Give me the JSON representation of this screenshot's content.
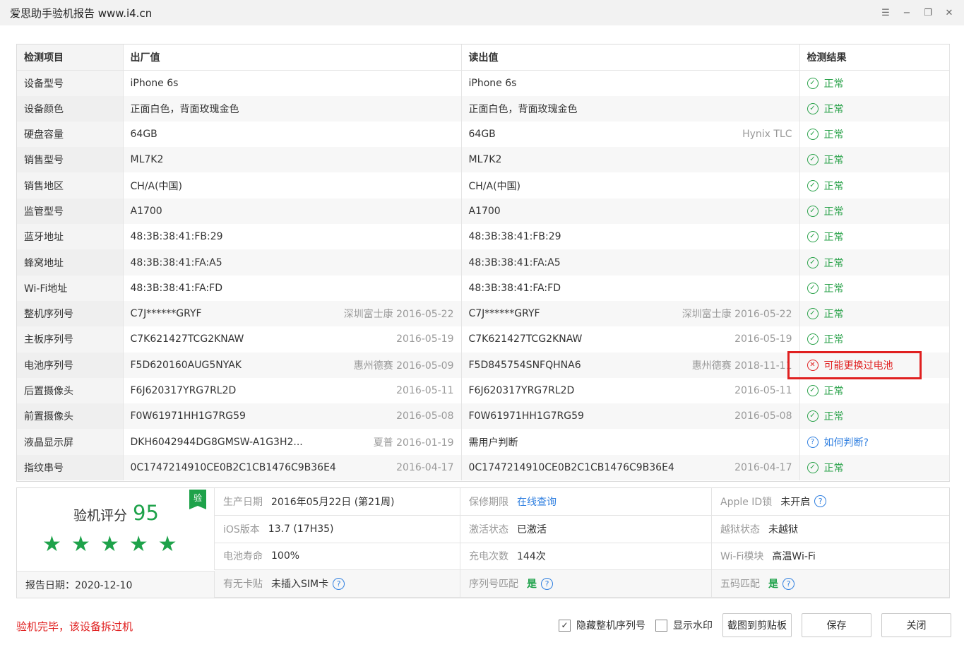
{
  "window": {
    "title": "爱思助手验机报告 www.i4.cn",
    "menu_icon": "☰",
    "minimize_icon": "−",
    "restore_icon": "❐",
    "close_icon": "✕"
  },
  "table": {
    "headers": [
      "检测项目",
      "出厂值",
      "读出值",
      "检测结果"
    ],
    "rows": [
      {
        "item": "设备型号",
        "factory": "iPhone 6s",
        "factory_meta": "",
        "read": "iPhone 6s",
        "read_meta": "",
        "result": "正常",
        "status": "ok"
      },
      {
        "item": "设备颜色",
        "factory": "正面白色，背面玫瑰金色",
        "factory_meta": "",
        "read": "正面白色，背面玫瑰金色",
        "read_meta": "",
        "result": "正常",
        "status": "ok"
      },
      {
        "item": "硬盘容量",
        "factory": "64GB",
        "factory_meta": "",
        "read": "64GB",
        "read_meta": "Hynix TLC",
        "result": "正常",
        "status": "ok"
      },
      {
        "item": "销售型号",
        "factory": "ML7K2",
        "factory_meta": "",
        "read": "ML7K2",
        "read_meta": "",
        "result": "正常",
        "status": "ok"
      },
      {
        "item": "销售地区",
        "factory": "CH/A(中国)",
        "factory_meta": "",
        "read": "CH/A(中国)",
        "read_meta": "",
        "result": "正常",
        "status": "ok"
      },
      {
        "item": "监管型号",
        "factory": "A1700",
        "factory_meta": "",
        "read": "A1700",
        "read_meta": "",
        "result": "正常",
        "status": "ok"
      },
      {
        "item": "蓝牙地址",
        "factory": "48:3B:38:41:FB:29",
        "factory_meta": "",
        "read": "48:3B:38:41:FB:29",
        "read_meta": "",
        "result": "正常",
        "status": "ok"
      },
      {
        "item": "蜂窝地址",
        "factory": "48:3B:38:41:FA:A5",
        "factory_meta": "",
        "read": "48:3B:38:41:FA:A5",
        "read_meta": "",
        "result": "正常",
        "status": "ok"
      },
      {
        "item": "Wi-Fi地址",
        "factory": "48:3B:38:41:FA:FD",
        "factory_meta": "",
        "read": "48:3B:38:41:FA:FD",
        "read_meta": "",
        "result": "正常",
        "status": "ok"
      },
      {
        "item": "整机序列号",
        "factory": "C7J******GRYF",
        "factory_meta": "深圳富士康 2016-05-22",
        "read": "C7J******GRYF",
        "read_meta": "深圳富士康 2016-05-22",
        "result": "正常",
        "status": "ok"
      },
      {
        "item": "主板序列号",
        "factory": "C7K621427TCG2KNAW",
        "factory_meta": "2016-05-19",
        "read": "C7K621427TCG2KNAW",
        "read_meta": "2016-05-19",
        "result": "正常",
        "status": "ok"
      },
      {
        "item": "电池序列号",
        "factory": "F5D620160AUG5NYAK",
        "factory_meta": "惠州德赛 2016-05-09",
        "read": "F5D845754SNFQHNA6",
        "read_meta": "惠州德赛 2018-11-11",
        "result": "可能更换过电池",
        "status": "bad"
      },
      {
        "item": "后置摄像头",
        "factory": "F6J620317YRG7RL2D",
        "factory_meta": "2016-05-11",
        "read": "F6J620317YRG7RL2D",
        "read_meta": "2016-05-11",
        "result": "正常",
        "status": "ok"
      },
      {
        "item": "前置摄像头",
        "factory": "F0W61971HH1G7RG59",
        "factory_meta": "2016-05-08",
        "read": "F0W61971HH1G7RG59",
        "read_meta": "2016-05-08",
        "result": "正常",
        "status": "ok"
      },
      {
        "item": "液晶显示屏",
        "factory": "DKH6042944DG8GMSW-A1G3H2...",
        "factory_meta": "夏普 2016-01-19",
        "read": "需用户判断",
        "read_meta": "",
        "result": "如何判断?",
        "status": "info"
      },
      {
        "item": "指纹串号",
        "factory": "0C1747214910CE0B2C1CB1476C9B36E4",
        "factory_meta": "2016-04-17",
        "read": "0C1747214910CE0B2C1CB1476C9B36E4",
        "read_meta": "2016-04-17",
        "result": "正常",
        "status": "ok"
      }
    ]
  },
  "score": {
    "label": "验机评分",
    "value": "95",
    "stars": 5,
    "badge": "验",
    "report_date": "报告日期：2020-12-10"
  },
  "info_grid": [
    [
      {
        "label": "生产日期",
        "value": "2016年05月22日 (第21周)",
        "style": "",
        "help": false
      },
      {
        "label": "保修期限",
        "value": "在线查询",
        "style": "link",
        "help": false
      },
      {
        "label": "Apple ID锁",
        "value": "未开启",
        "style": "",
        "help": true
      }
    ],
    [
      {
        "label": "iOS版本",
        "value": "13.7 (17H35)",
        "style": "",
        "help": false
      },
      {
        "label": "激活状态",
        "value": "已激活",
        "style": "",
        "help": false
      },
      {
        "label": "越狱状态",
        "value": "未越狱",
        "style": "",
        "help": false
      }
    ],
    [
      {
        "label": "电池寿命",
        "value": "100%",
        "style": "",
        "help": false
      },
      {
        "label": "充电次数",
        "value": "144次",
        "style": "",
        "help": false
      },
      {
        "label": "Wi-Fi模块",
        "value": "高温Wi-Fi",
        "style": "",
        "help": false
      }
    ],
    [
      {
        "label": "有无卡贴",
        "value": "未插入SIM卡",
        "style": "",
        "help": true
      },
      {
        "label": "序列号匹配",
        "value": "是",
        "style": "green",
        "help": true
      },
      {
        "label": "五码匹配",
        "value": "是",
        "style": "green",
        "help": true
      }
    ]
  ],
  "footer": {
    "message": "验机完毕，该设备拆过机",
    "hide_serial_label": "隐藏整机序列号",
    "hide_serial_checked": true,
    "watermark_label": "显示水印",
    "watermark_checked": false,
    "screenshot_button": "截图到剪贴板",
    "save_button": "保存",
    "close_button": "关闭"
  },
  "colors": {
    "ok": "#2aa24a",
    "bad": "#e02020",
    "info": "#2f7fe0"
  }
}
